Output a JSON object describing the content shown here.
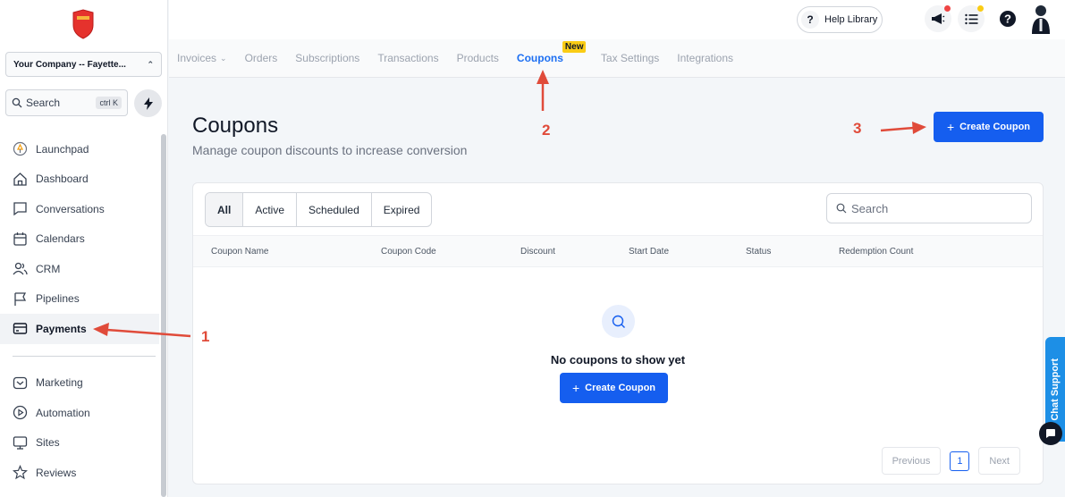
{
  "sidebar": {
    "company": "Your Company -- Fayette...",
    "search_placeholder": "Search",
    "search_shortcut": "ctrl K",
    "items": [
      {
        "label": "Launchpad",
        "icon": "launchpad-icon"
      },
      {
        "label": "Dashboard",
        "icon": "home-icon"
      },
      {
        "label": "Conversations",
        "icon": "chat-icon"
      },
      {
        "label": "Calendars",
        "icon": "calendar-icon"
      },
      {
        "label": "CRM",
        "icon": "contacts-icon"
      },
      {
        "label": "Pipelines",
        "icon": "flag-icon"
      },
      {
        "label": "Payments",
        "icon": "payments-icon",
        "active": true
      },
      {
        "label": "Marketing",
        "icon": "marketing-icon"
      },
      {
        "label": "Automation",
        "icon": "automation-icon"
      },
      {
        "label": "Sites",
        "icon": "sites-icon"
      },
      {
        "label": "Reviews",
        "icon": "star-icon"
      }
    ]
  },
  "topbar": {
    "help_label": "Help Library"
  },
  "tabs": {
    "items": [
      "Invoices",
      "Orders",
      "Subscriptions",
      "Transactions",
      "Products",
      "Coupons",
      "Tax Settings",
      "Integrations"
    ],
    "active": "Coupons",
    "new_badge": "New"
  },
  "page": {
    "title": "Coupons",
    "subtitle": "Manage coupon discounts to increase conversion",
    "create_button": "Create Coupon"
  },
  "filters": [
    "All",
    "Active",
    "Scheduled",
    "Expired"
  ],
  "search_placeholder": "Search",
  "table": {
    "columns": [
      "Coupon Name",
      "Coupon Code",
      "Discount",
      "Start Date",
      "Status",
      "Redemption Count"
    ]
  },
  "empty": {
    "text": "No coupons to show yet",
    "button": "Create Coupon"
  },
  "pagination": {
    "previous": "Previous",
    "page": "1",
    "next": "Next"
  },
  "annotations": [
    "1",
    "2",
    "3"
  ],
  "chat_support": "Chat Support",
  "colors": {
    "primary": "#155eef",
    "annotation": "#e04b3a",
    "new_badge": "#facc15",
    "chat": "#1d8fe6"
  }
}
